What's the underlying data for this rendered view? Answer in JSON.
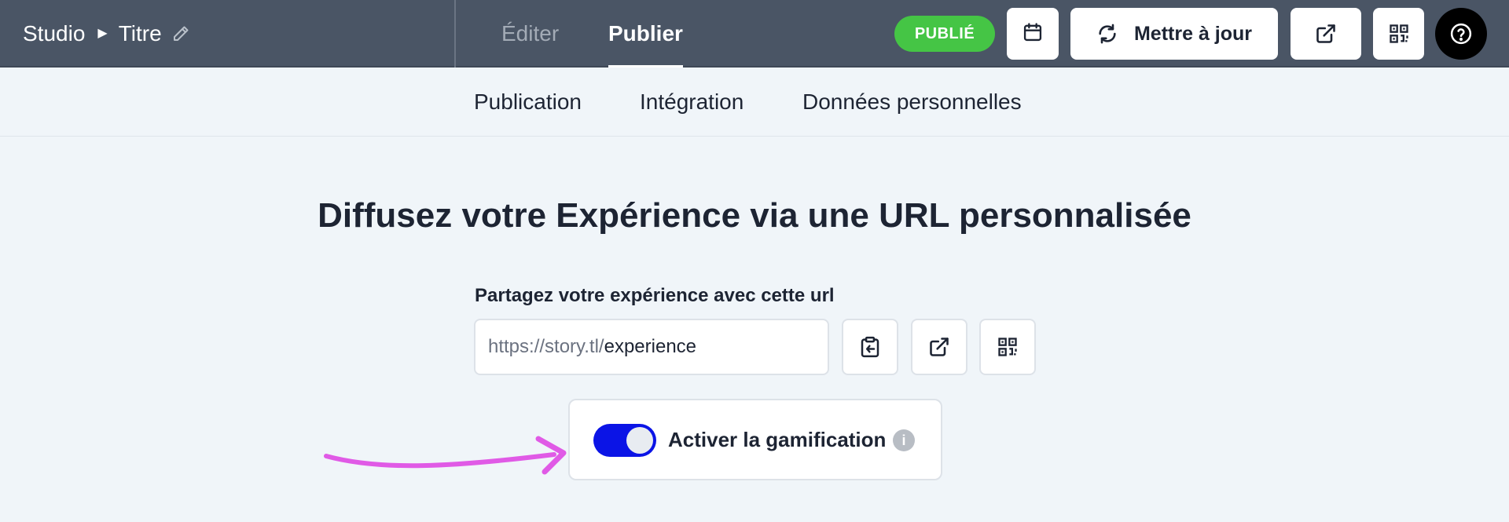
{
  "breadcrumb": {
    "root": "Studio",
    "title": "Titre"
  },
  "mode_tabs": [
    {
      "label": "Éditer",
      "active": false
    },
    {
      "label": "Publier",
      "active": true
    }
  ],
  "status_badge": "PUBLIÉ",
  "toolbar": {
    "update_label": "Mettre à jour"
  },
  "subnav": {
    "items": [
      {
        "label": "Publication"
      },
      {
        "label": "Intégration"
      },
      {
        "label": "Données personnelles"
      }
    ]
  },
  "main": {
    "heading": "Diffusez votre Expérience via une URL personnalisée",
    "url_label": "Partagez votre expérience avec cette url",
    "url_prefix": "https://story.tl/",
    "url_value": "experience"
  },
  "gamification": {
    "label": "Activer la gamification",
    "enabled": true,
    "info_glyph": "i"
  },
  "icons": {
    "crumb_separator": "caret-right-icon",
    "edit": "pencil-icon",
    "schedule": "calendar-icon",
    "update": "refresh-icon",
    "open": "external-link-icon",
    "qr": "qr-code-icon",
    "help": "help-circle-icon",
    "copy": "clipboard-copy-icon"
  },
  "colors": {
    "topbar": "#4a5565",
    "badge": "#45c545",
    "toggle_on": "#0b14e6",
    "annotation_arrow": "#e05ae6"
  }
}
